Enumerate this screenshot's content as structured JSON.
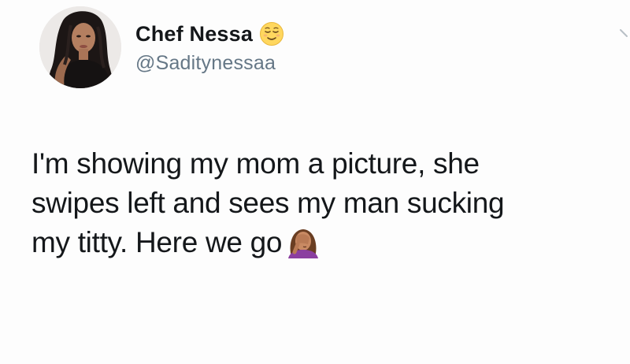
{
  "tweet": {
    "display_name": "Chef Nessa",
    "handle": "@Saditynessaa",
    "name_emoji": "relieved-face-emoji",
    "text_lines": [
      "I'm showing my mom a picture, she",
      "swipes left and sees my man sucking",
      "my titty. Here we go"
    ],
    "trailing_emoji": "woman-facepalming-emoji"
  },
  "colors": {
    "name": "#14171a",
    "handle": "#657786",
    "background": "#ffffff"
  }
}
